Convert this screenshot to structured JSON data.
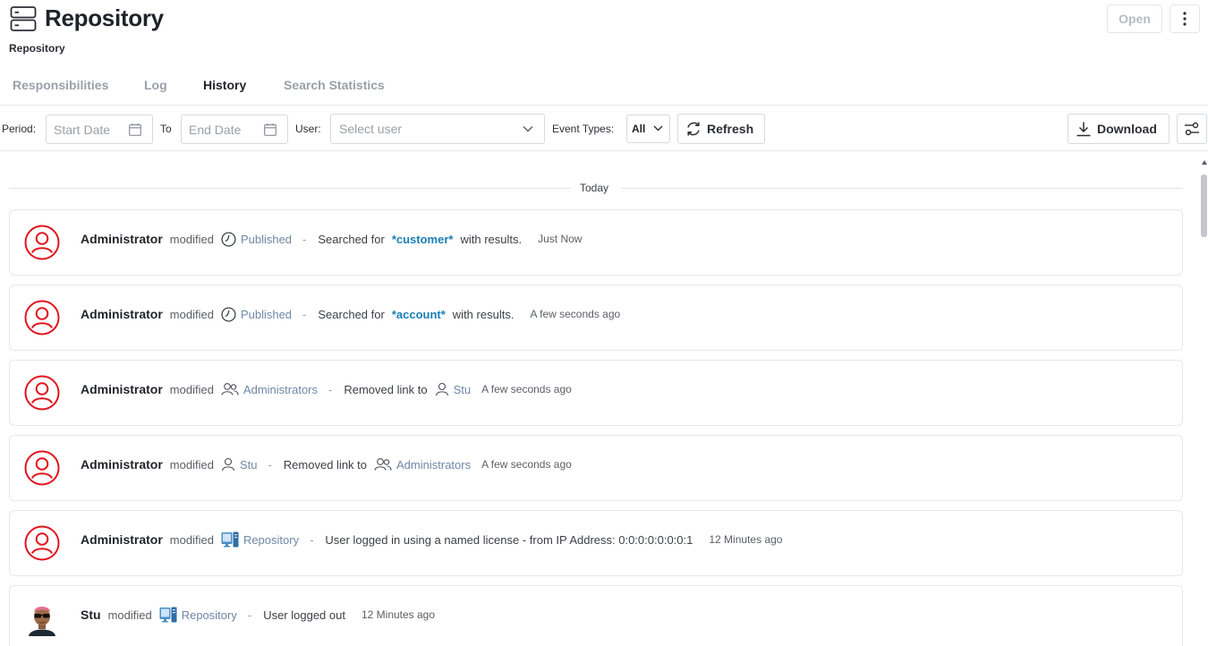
{
  "header": {
    "title": "Repository",
    "subtitle": "Repository",
    "open_label": "Open",
    "icon": "server-icon"
  },
  "tabs": [
    {
      "label": "Responsibilities",
      "active": false
    },
    {
      "label": "Log",
      "active": false
    },
    {
      "label": "History",
      "active": true
    },
    {
      "label": "Search Statistics",
      "active": false
    }
  ],
  "filters": {
    "period_label": "Period:",
    "start_placeholder": "Start Date",
    "to_label": "To",
    "end_placeholder": "End Date",
    "user_label": "User:",
    "user_placeholder": "Select user",
    "event_types_label": "Event Types:",
    "event_types_value": "All",
    "refresh_label": "Refresh",
    "download_label": "Download"
  },
  "history": {
    "group_label": "Today",
    "entries": [
      {
        "user": "Administrator",
        "verb": "modified",
        "object": {
          "label": "Published",
          "icon": "clock-icon"
        },
        "dash": "-",
        "desc_before": "Searched for",
        "highlight": "*customer*",
        "desc_after": "with results.",
        "time": "Just Now",
        "avatar": "user-circle-icon"
      },
      {
        "user": "Administrator",
        "verb": "modified",
        "object": {
          "label": "Published",
          "icon": "clock-icon"
        },
        "dash": "-",
        "desc_before": "Searched for",
        "highlight": "*account*",
        "desc_after": "with results.",
        "time": "A few seconds ago",
        "avatar": "user-circle-icon"
      },
      {
        "user": "Administrator",
        "verb": "modified",
        "object": {
          "label": "Administrators",
          "icon": "users-icon"
        },
        "dash": "-",
        "desc_before": "Removed link to",
        "target": {
          "label": "Stu",
          "icon": "user-icon"
        },
        "time": "A few seconds ago",
        "avatar": "user-circle-icon"
      },
      {
        "user": "Administrator",
        "verb": "modified",
        "object": {
          "label": "Stu",
          "icon": "user-icon"
        },
        "dash": "-",
        "desc_before": "Removed link to",
        "target": {
          "label": "Administrators",
          "icon": "users-icon"
        },
        "time": "A few seconds ago",
        "avatar": "user-circle-icon"
      },
      {
        "user": "Administrator",
        "verb": "modified",
        "object": {
          "label": "Repository",
          "icon": "computer-icon"
        },
        "dash": "-",
        "desc_before": "User logged in using a named license - from IP Address: 0:0:0:0:0:0:0:1",
        "time": "12 Minutes ago",
        "avatar": "user-circle-icon"
      },
      {
        "user": "Stu",
        "verb": "modified",
        "object": {
          "label": "Repository",
          "icon": "computer-icon"
        },
        "dash": "-",
        "desc_before": "User logged out",
        "time": "12 Minutes ago",
        "avatar": "user-photo-avatar"
      }
    ]
  },
  "colors": {
    "accent": "#1a7fb5",
    "object_link": "#6f88a6",
    "avatar_red": "#e0141e"
  }
}
